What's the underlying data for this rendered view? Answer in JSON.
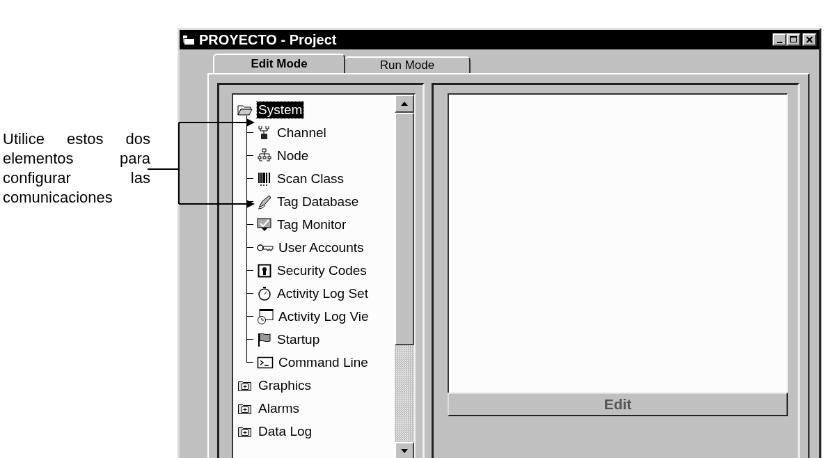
{
  "annotation": {
    "text": "Utilice estos dos elementos para configurar las comunicaciones"
  },
  "window": {
    "title": "PROYECTO - Project"
  },
  "tabs": [
    {
      "label": "Edit Mode",
      "selected": true
    },
    {
      "label": "Run Mode",
      "selected": false
    }
  ],
  "tree": [
    {
      "label": "System",
      "expanded": true,
      "selected": true,
      "children": [
        {
          "label": "Channel",
          "selected": false
        },
        {
          "label": "Node",
          "selected": false
        },
        {
          "label": "Scan Class",
          "selected": false
        },
        {
          "label": "Tag Database",
          "selected": false
        },
        {
          "label": "Tag Monitor",
          "selected": false
        },
        {
          "label": "User Accounts",
          "selected": false
        },
        {
          "label": "Security Codes",
          "selected": false
        },
        {
          "label": "Activity Log Set",
          "selected": false
        },
        {
          "label": "Activity Log Vie",
          "selected": false
        },
        {
          "label": "Startup",
          "selected": false
        },
        {
          "label": "Command Line",
          "selected": false
        }
      ]
    },
    {
      "label": "Graphics",
      "expanded": false,
      "selected": false
    },
    {
      "label": "Alarms",
      "expanded": false,
      "selected": false
    },
    {
      "label": "Data Log",
      "expanded": false,
      "selected": false
    }
  ],
  "edit_bar": {
    "label": "Edit"
  }
}
